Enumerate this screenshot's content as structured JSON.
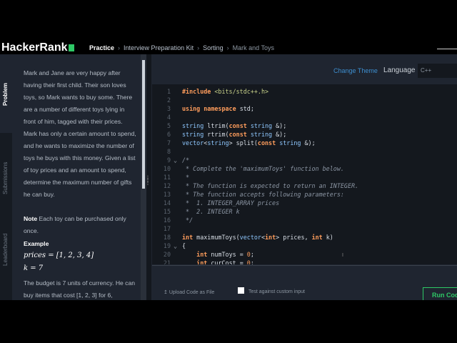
{
  "nav": {
    "logo": "HackerRank",
    "crumbs": [
      "Practice",
      "Interview Preparation Kit",
      "Sorting",
      "Mark and Toys"
    ]
  },
  "tabs": [
    "Problem",
    "Submissions",
    "Leaderboard"
  ],
  "problem": {
    "p1": "Mark and Jane are very happy after having their first child. Their son loves toys, so Mark wants to buy some. There are a number of different toys lying in front of him, tagged with their prices. Mark has only a certain amount to spend, and he wants to maximize the number of toys he buys with this money. Given a list of toy prices and an amount to spend, determine the maximum number of gifts he can buy.",
    "note_label": "Note",
    "note_text": "Each toy can be purchased only once.",
    "example_label": "Example",
    "prices_expr": "prices = [1, 2, 3, 4]",
    "k_expr": "k = 7",
    "budget_text": "The budget is 7 units of currency. He can buy items that cost [1, 2, 3] for 6,"
  },
  "editor_toolbar": {
    "change_theme": "Change Theme",
    "language_label": "Language",
    "language_value": "C++"
  },
  "code_lines": [
    {
      "n": "1",
      "fold": "",
      "text": "#include <bits/stdc++.h>"
    },
    {
      "n": "2",
      "fold": "",
      "text": ""
    },
    {
      "n": "3",
      "fold": "",
      "text": "using namespace std;"
    },
    {
      "n": "4",
      "fold": "",
      "text": ""
    },
    {
      "n": "5",
      "fold": "",
      "text": "string ltrim(const string &);"
    },
    {
      "n": "6",
      "fold": "",
      "text": "string rtrim(const string &);"
    },
    {
      "n": "7",
      "fold": "",
      "text": "vector<string> split(const string &);"
    },
    {
      "n": "8",
      "fold": "",
      "text": ""
    },
    {
      "n": "9",
      "fold": "v",
      "text": "/*"
    },
    {
      "n": "10",
      "fold": "",
      "text": " * Complete the 'maximumToys' function below."
    },
    {
      "n": "11",
      "fold": "",
      "text": " *"
    },
    {
      "n": "12",
      "fold": "",
      "text": " * The function is expected to return an INTEGER."
    },
    {
      "n": "13",
      "fold": "",
      "text": " * The function accepts following parameters:"
    },
    {
      "n": "14",
      "fold": "",
      "text": " *  1. INTEGER_ARRAY prices"
    },
    {
      "n": "15",
      "fold": "",
      "text": " *  2. INTEGER k"
    },
    {
      "n": "16",
      "fold": "",
      "text": " */"
    },
    {
      "n": "17",
      "fold": "",
      "text": ""
    },
    {
      "n": "18",
      "fold": "",
      "text": "int maximumToys(vector<int> prices, int k)"
    },
    {
      "n": "19",
      "fold": "v",
      "text": "{"
    },
    {
      "n": "20",
      "fold": "",
      "text": "    int numToys = 0;"
    },
    {
      "n": "21",
      "fold": "",
      "text": "    int curCost = 0;"
    }
  ],
  "footer": {
    "upload": "Upload Code as File",
    "custom_input": "Test against custom input",
    "run": "Run Code"
  },
  "colors": {
    "accent_green": "#2ec866",
    "link_blue": "#3d8ecf",
    "keyword": "#ff9d5c"
  }
}
